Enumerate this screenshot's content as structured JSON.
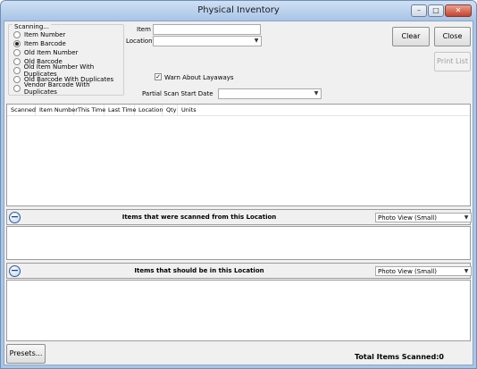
{
  "window": {
    "title": "Physical Inventory",
    "minimize": "–",
    "maximize": "□",
    "close": "✕"
  },
  "scanning": {
    "caption": "Scanning...",
    "options": [
      {
        "label": "Item Number",
        "checked": false
      },
      {
        "label": "Item Barcode",
        "checked": true
      },
      {
        "label": "Old Item Number",
        "checked": false
      },
      {
        "label": "Old Barcode",
        "checked": false
      },
      {
        "label": "Old Item Number With Duplicates",
        "checked": false
      },
      {
        "label": "Old Barcode With Duplicates",
        "checked": false
      },
      {
        "label": "Vendor Barcode With Duplicates",
        "checked": false
      }
    ]
  },
  "fields": {
    "item_label": "Item",
    "item_value": "",
    "location_label": "Location",
    "location_value": "",
    "warn_layaways_label": "Warn About Layaways",
    "warn_layaways_checked": true,
    "partial_scan_label": "Partial Scan Start Date",
    "partial_scan_value": ""
  },
  "buttons": {
    "clear": "Clear",
    "close": "Close",
    "print_list": "Print List",
    "presets": "Presets..."
  },
  "scan_list": {
    "columns": [
      "Scanned",
      "Item Number",
      "This Time",
      "Last Time",
      "Location",
      "Qty",
      "Units"
    ]
  },
  "section_scanned": {
    "title": "Items that were scanned from this Location",
    "view": "Photo View (Small)"
  },
  "section_expected": {
    "title": "Items that should be in this Location",
    "view": "Photo View (Small)"
  },
  "status": {
    "total_label": "Total Items Scanned:",
    "total_value": "0"
  }
}
